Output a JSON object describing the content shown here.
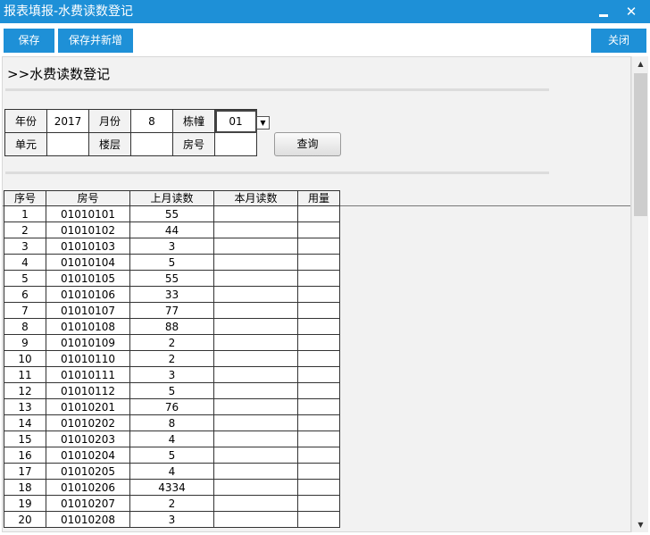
{
  "window": {
    "title": "报表填报-水费读数登记",
    "minimize_glyph": "–",
    "close_glyph": "✕"
  },
  "toolbar": {
    "save_label": "保存",
    "save_new_label": "保存并新增",
    "close_label": "关闭"
  },
  "page": {
    "heading": ">>水费读数登记"
  },
  "filters": {
    "year_label": "年份",
    "year_value": "2017",
    "month_label": "月份",
    "month_value": "8",
    "building_label": "栋幢",
    "building_value": "01",
    "unit_label": "单元",
    "unit_value": "",
    "floor_label": "楼层",
    "floor_value": "",
    "room_label": "房号",
    "room_value": "",
    "query_label": "查询"
  },
  "table": {
    "headers": [
      "序号",
      "房号",
      "上月读数",
      "本月读数",
      "用量"
    ],
    "rows": [
      [
        "1",
        "01010101",
        "55",
        "",
        ""
      ],
      [
        "2",
        "01010102",
        "44",
        "",
        ""
      ],
      [
        "3",
        "01010103",
        "3",
        "",
        ""
      ],
      [
        "4",
        "01010104",
        "5",
        "",
        ""
      ],
      [
        "5",
        "01010105",
        "55",
        "",
        ""
      ],
      [
        "6",
        "01010106",
        "33",
        "",
        ""
      ],
      [
        "7",
        "01010107",
        "77",
        "",
        ""
      ],
      [
        "8",
        "01010108",
        "88",
        "",
        ""
      ],
      [
        "9",
        "01010109",
        "2",
        "",
        ""
      ],
      [
        "10",
        "01010110",
        "2",
        "",
        ""
      ],
      [
        "11",
        "01010111",
        "3",
        "",
        ""
      ],
      [
        "12",
        "01010112",
        "5",
        "",
        ""
      ],
      [
        "13",
        "01010201",
        "76",
        "",
        ""
      ],
      [
        "14",
        "01010202",
        "8",
        "",
        ""
      ],
      [
        "15",
        "01010203",
        "4",
        "",
        ""
      ],
      [
        "16",
        "01010204",
        "5",
        "",
        ""
      ],
      [
        "17",
        "01010205",
        "4",
        "",
        ""
      ],
      [
        "18",
        "01010206",
        "4334",
        "",
        ""
      ],
      [
        "19",
        "01010207",
        "2",
        "",
        ""
      ],
      [
        "20",
        "01010208",
        "3",
        "",
        ""
      ]
    ]
  },
  "icons": {
    "dropdown": "chevron-down-icon",
    "scroll_up": "scroll-up-icon",
    "scroll_down": "scroll-down-icon"
  },
  "colors": {
    "accent": "#1e90d7"
  }
}
